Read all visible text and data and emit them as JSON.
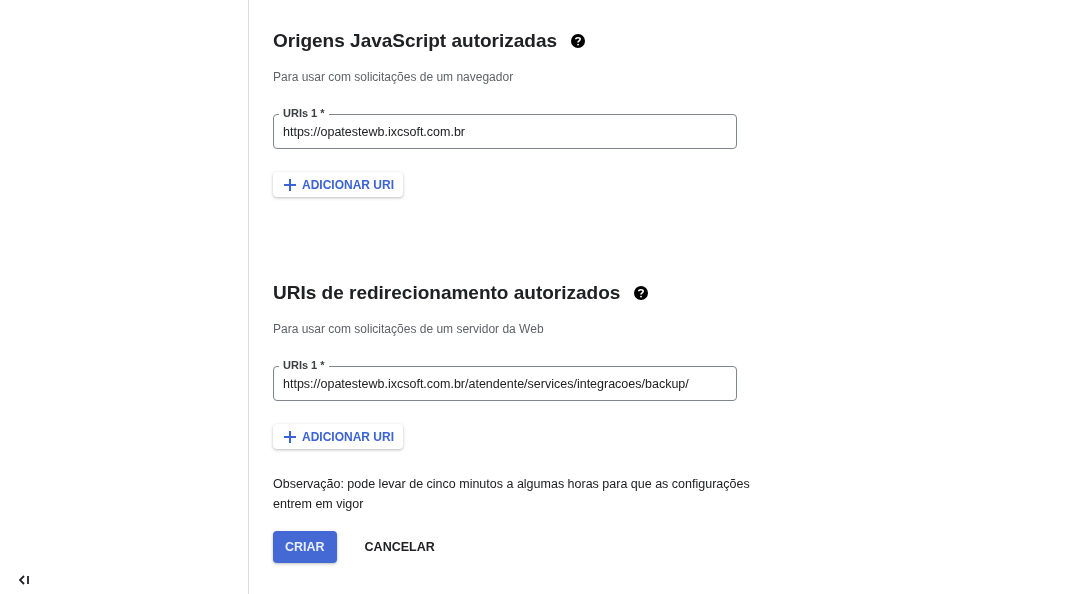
{
  "sections": [
    {
      "title": "Origens JavaScript autorizadas",
      "subtitle": "Para usar com solicitações de um navegador",
      "fields": [
        {
          "label": "URIs 1 *",
          "value": "https://opatestewb.ixcsoft.com.br"
        }
      ],
      "add_button": "ADICIONAR URI"
    },
    {
      "title": "URIs de redirecionamento autorizados",
      "subtitle": "Para usar com solicitações de um servidor da Web",
      "fields": [
        {
          "label": "URIs 1 *",
          "value": "https://opatestewb.ixcsoft.com.br/atendente/services/integracoes/backup/"
        }
      ],
      "add_button": "ADICIONAR URI"
    }
  ],
  "note": "Observação: pode levar de cinco minutos a algumas horas para que as configurações entrem em vigor",
  "actions": [
    {
      "label": "CRIAR",
      "kind": "primary"
    },
    {
      "label": "CANCELAR",
      "kind": "text"
    }
  ]
}
